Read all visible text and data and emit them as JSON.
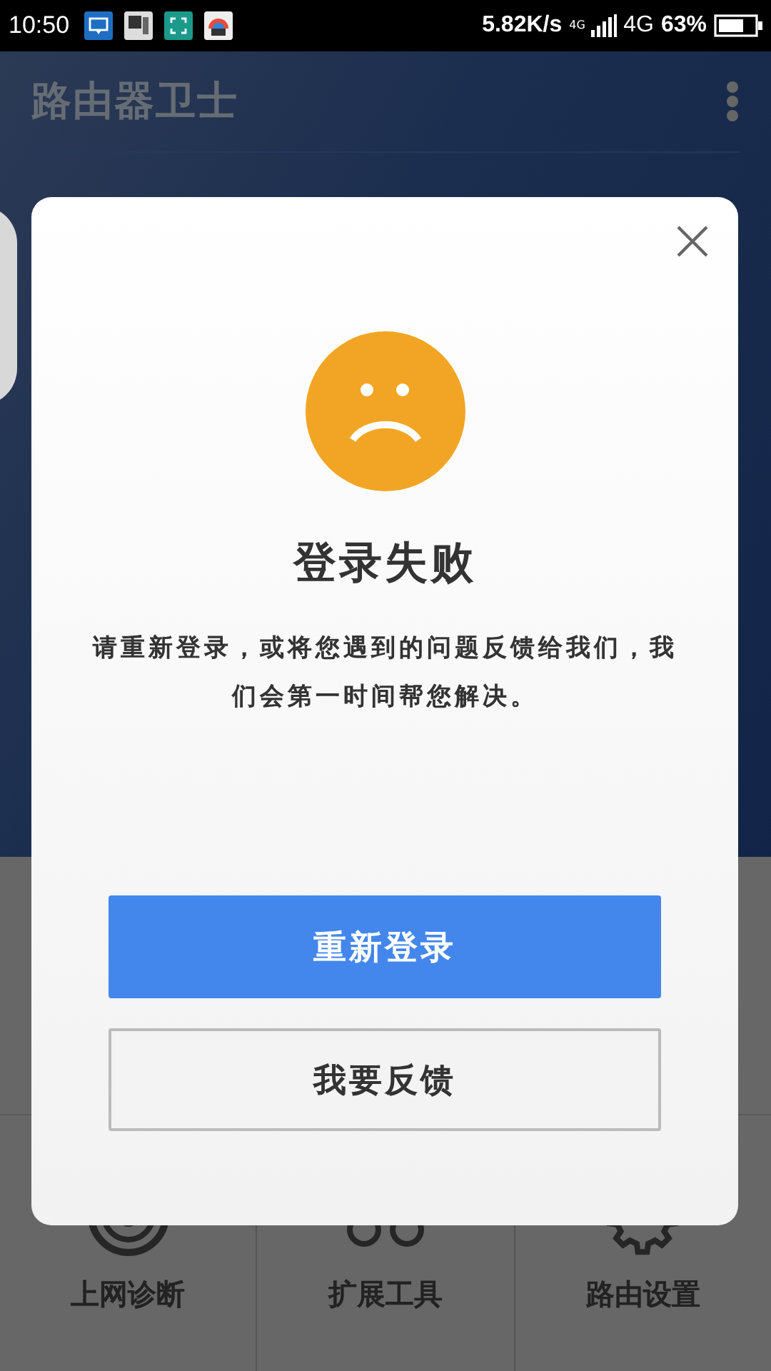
{
  "status_bar": {
    "time": "10:50",
    "net_speed": "5.82K/s",
    "network_small": "4G",
    "network": "4G",
    "battery": "63%"
  },
  "app_bar": {
    "title": "路由器卫士"
  },
  "bottom_tabs": [
    {
      "label": "上网诊断",
      "kind": "target"
    },
    {
      "label": "扩展工具",
      "kind": "circles"
    },
    {
      "label": "路由设置",
      "kind": "gear"
    }
  ],
  "dialog": {
    "title": "登录失败",
    "message": "请重新登录，或将您遇到的问题反馈给我们，我们会第一时间帮您解决。",
    "buttons": [
      {
        "label": "重新登录",
        "kind": "primary"
      },
      {
        "label": "我要反馈",
        "kind": "secondary"
      }
    ]
  }
}
